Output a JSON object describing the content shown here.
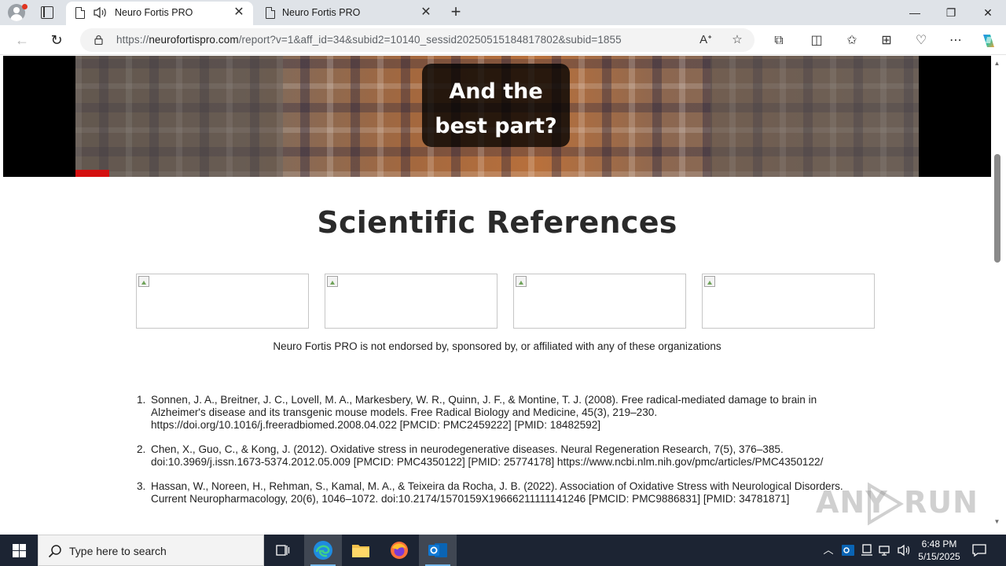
{
  "browser": {
    "tabs": [
      {
        "title": "Neuro Fortis PRO",
        "active": true,
        "audio": true
      },
      {
        "title": "Neuro Fortis PRO",
        "active": false,
        "audio": false
      }
    ],
    "address": {
      "prefix": "https://",
      "host": "neurofortispro.com",
      "path": "/report?v=1&aff_id=34&subid2=10140_sessid20250515184817802&subid=1855"
    }
  },
  "video": {
    "caption": "And the\nbest part?",
    "progress_fraction": 0.04
  },
  "page": {
    "heading": "Scientific References",
    "logo_count": 4,
    "disclaimer": "Neuro Fortis PRO is not endorsed by, sponsored by, or affiliated with any of these organizations",
    "references": [
      {
        "num": "1.",
        "text": "Sonnen, J. A., Breitner, J. C., Lovell, M. A., Markesbery, W. R., Quinn, J. F., & Montine, T. J. (2008). Free radical-mediated damage to brain in Alzheimer's disease and its transgenic mouse models. Free Radical Biology and Medicine, 45(3), 219–230. https://doi.org/10.1016/j.freeradbiomed.2008.04.022 [PMCID: PMC2459222] [PMID: 18482592]"
      },
      {
        "num": "2.",
        "text": "Chen, X., Guo, C., & Kong, J. (2012). Oxidative stress in neurodegenerative diseases. Neural Regeneration Research, 7(5), 376–385. doi:10.3969/j.issn.1673-5374.2012.05.009 [PMCID: PMC4350122] [PMID: 25774178] https://www.ncbi.nlm.nih.gov/pmc/articles/PMC4350122/"
      },
      {
        "num": "3.",
        "text": "Hassan, W., Noreen, H., Rehman, S., Kamal, M. A., & Teixeira da Rocha, J. B. (2022). Association of Oxidative Stress with Neurological Disorders. Current Neuropharmacology, 20(6), 1046–1072. doi:10.2174/1570159X19666211111141246 [PMCID: PMC9886831] [PMID: 34781871]"
      }
    ]
  },
  "watermark": "ANY RUN",
  "taskbar": {
    "search_placeholder": "Type here to search",
    "time": "6:48 PM",
    "date": "5/15/2025"
  },
  "colors": {
    "progress": "#d40f0f",
    "titlebar": "#dfe3e8",
    "taskbar": "#1c2433",
    "edge_blue": "#1f8be0",
    "outlook_blue": "#0a64b4"
  }
}
